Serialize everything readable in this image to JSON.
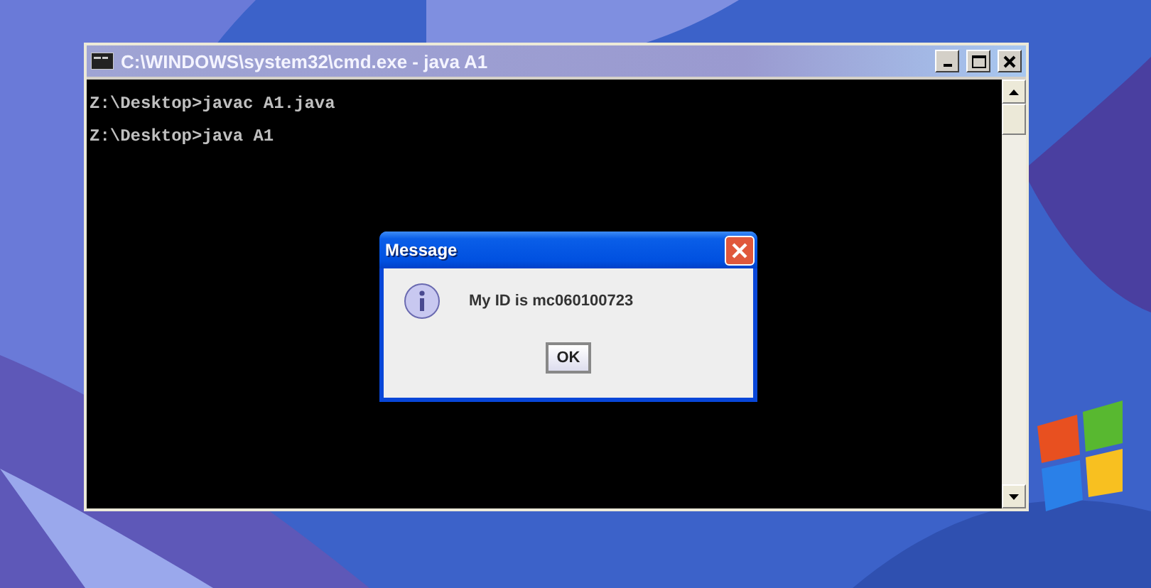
{
  "console_window": {
    "title": "C:\\WINDOWS\\system32\\cmd.exe - java A1",
    "lines": [
      "Z:\\Desktop>javac A1.java",
      "Z:\\Desktop>java A1"
    ]
  },
  "dialog": {
    "title": "Message",
    "message": "My ID is mc060100723",
    "buttons": [
      "OK"
    ]
  }
}
